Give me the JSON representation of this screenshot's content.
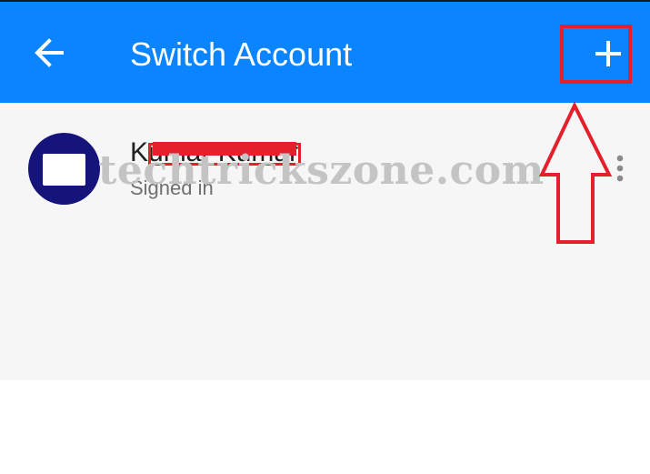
{
  "app_bar": {
    "title": "Switch Account",
    "background_color": "#0a84ff",
    "back_icon": "arrow-left-icon",
    "add_icon": "plus-icon"
  },
  "account": {
    "name": "Kumar Kumar",
    "status": "Signed in",
    "avatar_color": "#14147a",
    "menu_icon": "more-vertical-icon"
  },
  "watermark": {
    "text": "techtrickszone.com"
  },
  "annotation": {
    "color": "#e4202d"
  }
}
